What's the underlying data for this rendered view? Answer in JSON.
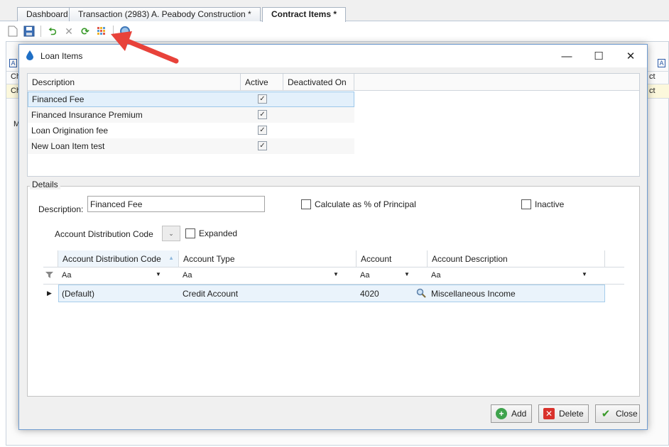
{
  "tabs": [
    {
      "label": "Dashboard",
      "active": false
    },
    {
      "label": "Transaction (2983) A. Peabody Construction *",
      "active": false
    },
    {
      "label": "Contract Items *",
      "active": true
    }
  ],
  "toolbar_icons": [
    "new-icon",
    "save-icon",
    "undo-icon",
    "delete-icon",
    "refresh-icon",
    "grid-layout-icon",
    "search-icon"
  ],
  "background_cells": {
    "row1_prefix": "Ch",
    "row2_prefix": "Ch",
    "row1_suffix": "ct",
    "row2_suffix": "ct",
    "letter_a": "A",
    "letter_m": "M"
  },
  "dialog": {
    "title": "Loan Items",
    "minimize": "—",
    "maximize": "☐",
    "close": "✕"
  },
  "items_grid": {
    "columns": [
      "Description",
      "Active",
      "Deactivated On"
    ],
    "rows": [
      {
        "description": "Financed Fee",
        "active": true,
        "deactivated_on": "",
        "selected": true
      },
      {
        "description": "Financed Insurance Premium",
        "active": true,
        "deactivated_on": "",
        "selected": false
      },
      {
        "description": "Loan Origination fee",
        "active": true,
        "deactivated_on": "",
        "selected": false
      },
      {
        "description": "New Loan Item test",
        "active": true,
        "deactivated_on": "",
        "selected": false
      }
    ]
  },
  "details": {
    "legend": "Details",
    "description_label": "Description:",
    "description_value": "Financed Fee",
    "calc_percent_label": "Calculate as % of Principal",
    "calc_percent_checked": false,
    "inactive_label": "Inactive",
    "inactive_checked": false,
    "adc_label": "Account Distribution Code",
    "expanded_label": "Expanded",
    "expanded_checked": false
  },
  "distribution_grid": {
    "columns": [
      "Account Distribution Code",
      "Account Type",
      "Account",
      "Account Description"
    ],
    "filter_placeholder": "Aa",
    "rows": [
      {
        "code": "(Default)",
        "type": "Credit Account",
        "account": "4020",
        "description": "Miscellaneous Income"
      }
    ]
  },
  "buttons": {
    "add": "Add",
    "delete": "Delete",
    "close": "Close"
  },
  "colors": {
    "dialog_border": "#6e9bd0",
    "selection_bg": "#e3f0fb",
    "annotation_arrow": "#e8423a"
  }
}
